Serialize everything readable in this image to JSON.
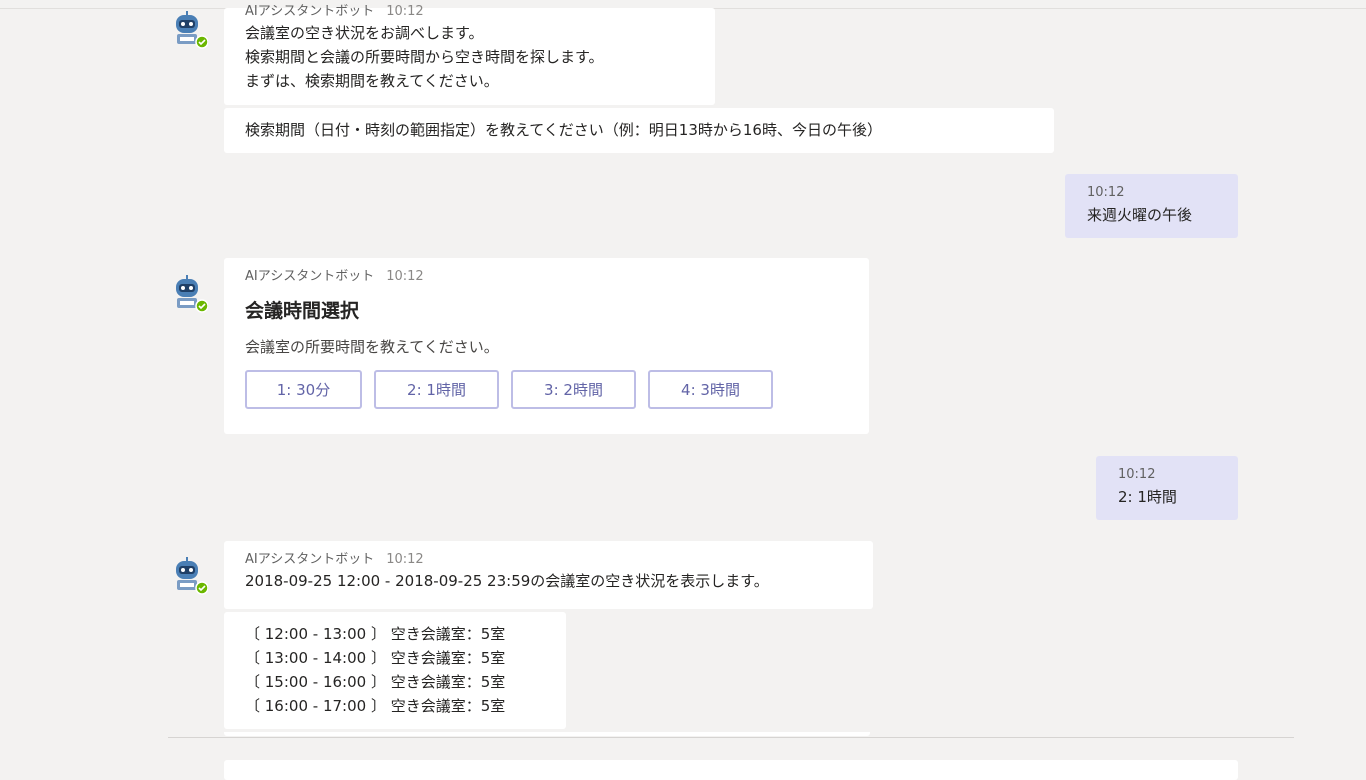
{
  "bot": {
    "name": "AIアシスタントボット",
    "avatar_icon": "bot-icon"
  },
  "messages": [
    {
      "time": "10:12",
      "lines": [
        "会議室の空き状況をお調べします。",
        "検索期間と会議の所要時間から空き時間を探します。",
        "まずは、検索期間を教えてください。"
      ],
      "followup": "検索期間（日付・時刻の範囲指定）を教えてください（例：明日13時から16時、今日の午後）"
    },
    {
      "user_time": "10:12",
      "user_text": "来週火曜の午後"
    },
    {
      "time": "10:12",
      "card": {
        "title": "会議時間選択",
        "text": "会議室の所要時間を教えてください。",
        "choices": [
          "1: 30分",
          "2: 1時間",
          "3: 2時間",
          "4: 3時間"
        ]
      }
    },
    {
      "user_time": "10:12",
      "user_text": "2: 1時間"
    },
    {
      "time": "10:12",
      "text": "2018-09-25 12:00 - 2018-09-25 23:59の会議室の空き状況を表示します。",
      "slots": [
        "〔 12:00 - 13:00 〕 空き会議室：5室",
        "〔 13:00 - 14:00 〕 空き会議室：5室",
        "〔 15:00 - 16:00 〕 空き会議室：5室",
        "〔 16:00 - 17:00 〕 空き会議室：5室"
      ]
    }
  ],
  "colors": {
    "background": "#f3f2f1",
    "bot_bubble": "#ffffff",
    "user_bubble": "#e2e2f6",
    "accent": "#6264a7",
    "status_online": "#6bb700"
  }
}
